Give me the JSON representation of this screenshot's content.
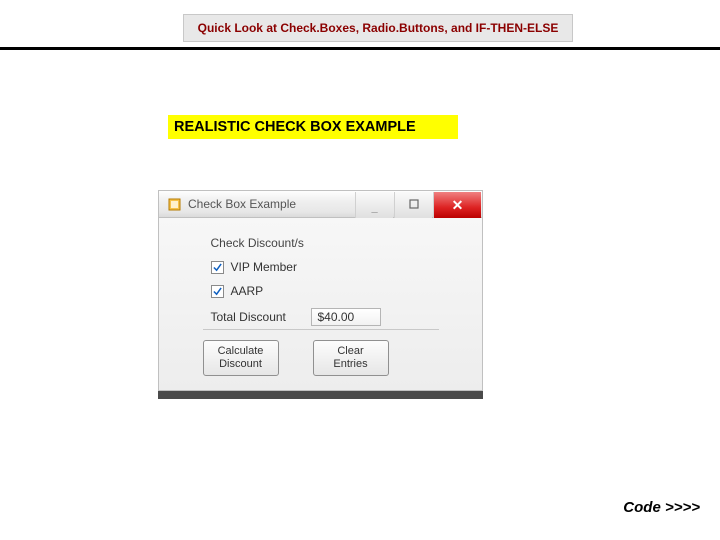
{
  "slide": {
    "header_title": "Quick Look at Check.Boxes, Radio.Buttons, and IF-THEN-ELSE",
    "example_label": "REALISTIC CHECK BOX EXAMPLE",
    "code_link": "Code >>>>"
  },
  "window": {
    "title": "Check Box Example",
    "buttons": {
      "minimize": "—",
      "maximize": "□",
      "close": "✕"
    },
    "form": {
      "section_label": "Check Discount/s",
      "checkbox_vip": {
        "label": "VIP Member",
        "checked": true
      },
      "checkbox_aarp": {
        "label": "AARP",
        "checked": true
      },
      "total_label": "Total Discount",
      "total_value": "$40.00",
      "btn_calculate": "Calculate\nDiscount",
      "btn_clear": "Clear\nEntries"
    }
  }
}
